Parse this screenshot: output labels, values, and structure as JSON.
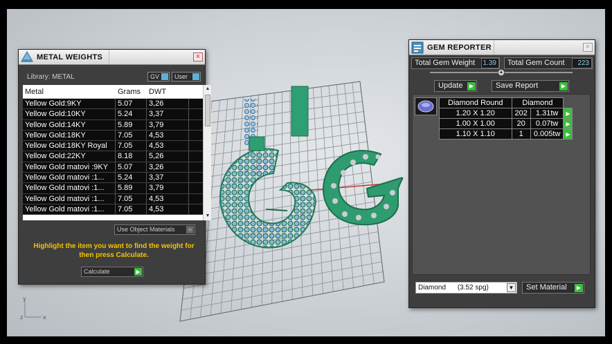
{
  "metal_weights": {
    "title": "METAL WEIGHTS",
    "library_label": "Library: METAL",
    "gv_label": "GV",
    "user_label": "User",
    "columns": [
      "Metal",
      "Grams",
      "DWT"
    ],
    "rows": [
      [
        "Yellow Gold:9KY",
        "5.07",
        "3,26"
      ],
      [
        "Yellow Gold:10KY",
        "5.24",
        "3,37"
      ],
      [
        "Yellow Gold:14KY",
        "5.89",
        "3,79"
      ],
      [
        "Yellow Gold:18KY",
        "7.05",
        "4,53"
      ],
      [
        "Yellow Gold:18KY Royal",
        "7.05",
        "4,53"
      ],
      [
        "Yellow Gold:22KY",
        "8.18",
        "5,26"
      ],
      [
        "Yellow Gold matovi :9KY",
        "5.07",
        "3,26"
      ],
      [
        "Yellow Gold matovi :1...",
        "5.24",
        "3,37"
      ],
      [
        "Yellow Gold matovi :1...",
        "5.89",
        "3,79"
      ],
      [
        "Yellow Gold matovi :1...",
        "7.05",
        "4,53"
      ],
      [
        "Yellow Gold matovi :1...",
        "7.05",
        "4,53"
      ]
    ],
    "use_object_materials": "Use Object Materials",
    "hint": "Highlight the item you want to find the weight for then press Calculate.",
    "calculate_label": "Calculate"
  },
  "gem_reporter": {
    "title": "GEM REPORTER",
    "total_weight_label": "Total Gem Weight",
    "total_weight_value": "1.39",
    "total_count_label": "Total Gem Count",
    "total_count_value": "223",
    "update_label": "Update",
    "save_report_label": "Save Report",
    "table_headers": [
      "Diamond Round",
      "Diamond"
    ],
    "gems": [
      [
        "1.20 X 1.20",
        "202",
        "1.31tw"
      ],
      [
        "1.00 X 1.00",
        "20",
        "0.07tw"
      ],
      [
        "1.10 X 1.10",
        "1",
        "0.005tw"
      ]
    ],
    "material_select": "Diamond",
    "material_spg": "(3.52 spg)",
    "set_material_label": "Set Material"
  },
  "viewport": {
    "axis_x": "x",
    "axis_y": "y",
    "axis_z": "z"
  },
  "colors": {
    "model_green": "#2e9e73",
    "accent_green": "#3cbd3c",
    "hint_yellow": "#f4c400"
  }
}
